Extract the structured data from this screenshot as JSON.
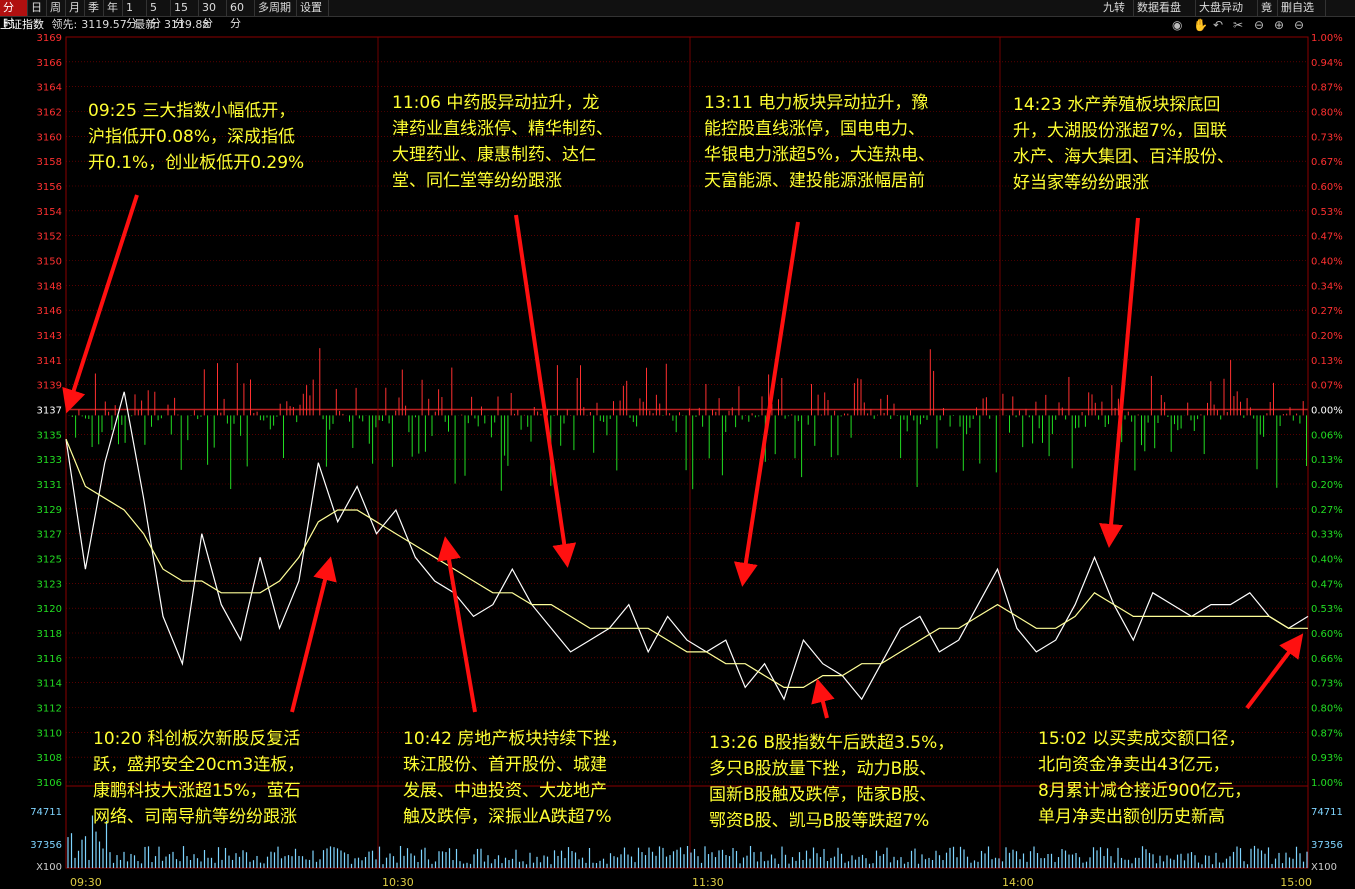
{
  "toolbar": {
    "left_items": [
      "分时",
      "日",
      "周",
      "月",
      "季",
      "年",
      "1分",
      "5分",
      "15分",
      "30分",
      "60分",
      "多周期",
      "设置"
    ],
    "right_items": [
      "九转",
      "数据看盘",
      "大盘异动",
      "竟",
      "删自选"
    ]
  },
  "info": {
    "name": "上证指数",
    "lead_label": "领先:",
    "lead_value": "3119.57",
    "latest_label": "最新:",
    "latest_value": "3119.88"
  },
  "colors": {
    "up": "#ff3030",
    "down": "#22dd22",
    "grid": "#8b0000",
    "price": "#ffffff",
    "avg": "#ffff99",
    "annotation": "#ffff33",
    "arrow": "#ff1010",
    "volume": "#7fd4ff"
  },
  "chart_data": {
    "type": "line",
    "title": "上证指数",
    "prev_close": 3137,
    "y_ticks_left": [
      "3169",
      "3166",
      "3164",
      "3162",
      "3160",
      "3158",
      "3156",
      "3154",
      "3152",
      "3150",
      "3148",
      "3146",
      "3143",
      "3141",
      "3139",
      "3137",
      "3135",
      "3133",
      "3131",
      "3129",
      "3127",
      "3125",
      "3123",
      "3120",
      "3118",
      "3116",
      "3114",
      "3112",
      "3110",
      "3108",
      "3106"
    ],
    "y_ticks_right": [
      "1.00%",
      "0.94%",
      "0.87%",
      "0.80%",
      "0.73%",
      "0.67%",
      "0.60%",
      "0.53%",
      "0.47%",
      "0.40%",
      "0.34%",
      "0.27%",
      "0.20%",
      "0.13%",
      "0.07%",
      "0.00%",
      "0.06%",
      "0.13%",
      "0.20%",
      "0.27%",
      "0.33%",
      "0.40%",
      "0.47%",
      "0.53%",
      "0.60%",
      "0.66%",
      "0.73%",
      "0.80%",
      "0.87%",
      "0.93%",
      "1.00%"
    ],
    "x_ticks": [
      "09:30",
      "10:30",
      "11:30",
      "14:00",
      "15:00"
    ],
    "volume_ticks": [
      "74711",
      "37356",
      "X100"
    ],
    "series": [
      {
        "name": "最新",
        "values": [
          3135,
          3124,
          3133,
          3139,
          3130,
          3120,
          3116,
          3127,
          3121,
          3118,
          3125,
          3119,
          3123,
          3133,
          3128,
          3131,
          3127,
          3129,
          3125,
          3123,
          3122,
          3120,
          3121,
          3124,
          3121,
          3119,
          3117,
          3118,
          3119,
          3121,
          3117,
          3120,
          3118,
          3117,
          3118,
          3114,
          3116,
          3113,
          3118,
          3116,
          3115,
          3113,
          3116,
          3119,
          3120,
          3117,
          3118,
          3121,
          3124,
          3119,
          3117,
          3118,
          3121,
          3125,
          3121,
          3118,
          3122,
          3121,
          3120,
          3121,
          3121,
          3122,
          3120,
          3119,
          3120
        ]
      },
      {
        "name": "均价",
        "values": [
          3135,
          3131,
          3130,
          3129,
          3127,
          3124,
          3123,
          3123,
          3122,
          3122,
          3122,
          3123,
          3125,
          3128,
          3129,
          3129,
          3128,
          3127,
          3126,
          3125,
          3124,
          3123,
          3122,
          3122,
          3121,
          3121,
          3120,
          3119,
          3119,
          3119,
          3119,
          3118,
          3117,
          3117,
          3116,
          3116,
          3115,
          3114,
          3114,
          3115,
          3115,
          3116,
          3116,
          3117,
          3118,
          3119,
          3119,
          3120,
          3121,
          3120,
          3119,
          3119,
          3120,
          3122,
          3121,
          3120,
          3120,
          3120,
          3120,
          3120,
          3120,
          3120,
          3120,
          3119,
          3119
        ]
      }
    ]
  },
  "annotations": [
    {
      "time": "09:25",
      "text": "09:25 三大指数小幅低开，\n沪指低开0.08%，深成指低\n开0.1%，创业板低开0.29%"
    },
    {
      "time": "11:06",
      "text": "11:06 中药股异动拉升，龙\n津药业直线涨停、精华制药、\n大理药业、康惠制药、达仁\n堂、同仁堂等纷纷跟涨"
    },
    {
      "time": "13:11",
      "text": "13:11 电力板块异动拉升，豫\n能控股直线涨停，国电电力、\n华银电力涨超5%，大连热电、\n天富能源、建投能源涨幅居前"
    },
    {
      "time": "14:23",
      "text": "14:23 水产养殖板块探底回\n升，大湖股份涨超7%，国联\n水产、海大集团、百洋股份、\n好当家等纷纷跟涨"
    },
    {
      "time": "10:20",
      "text": "10:20 科创板次新股反复活\n跃，盛邦安全20cm3连板，\n康鹏科技大涨超15%，萤石\n网络、司南导航等纷纷跟涨"
    },
    {
      "time": "10:42",
      "text": "10:42 房地产板块持续下挫，\n珠江股份、首开股份、城建\n发展、中迪投资、大龙地产\n触及跌停，深振业A跌超7%"
    },
    {
      "time": "13:26",
      "text": "13:26 B股指数午后跌超3.5%，\n多只B股放量下挫，动力B股、\n国新B股触及跌停，陆家B股、\n鄂资B股、凯马B股等跌超7%"
    },
    {
      "time": "15:02",
      "text": "15:02 以买卖成交额口径，\n北向资金净卖出43亿元，\n8月累计减仓接近900亿元，\n单月净卖出额创历史新高"
    }
  ]
}
